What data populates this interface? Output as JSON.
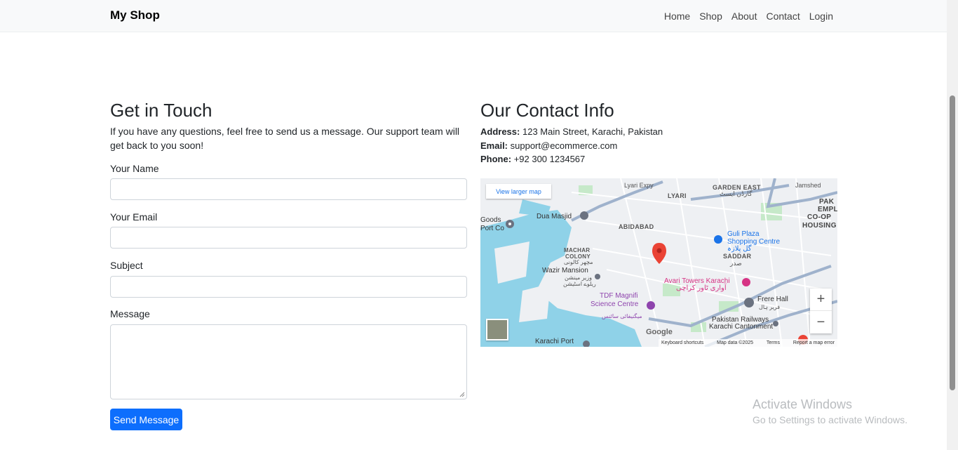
{
  "navbar": {
    "brand": "My Shop",
    "links": [
      "Home",
      "Shop",
      "About",
      "Contact",
      "Login"
    ]
  },
  "contact_form": {
    "title": "Get in Touch",
    "intro": "If you have any questions, feel free to send us a message. Our support team will get back to you soon!",
    "name_label": "Your Name",
    "email_label": "Your Email",
    "subject_label": "Subject",
    "message_label": "Message",
    "submit_label": "Send Message"
  },
  "contact_info": {
    "title": "Our Contact Info",
    "address_label": "Address:",
    "address": "123 Main Street, Karachi, Pakistan",
    "email_label": "Email:",
    "email": "support@ecommerce.com",
    "phone_label": "Phone:",
    "phone": "+92 300 1234567"
  },
  "map": {
    "view_larger": "View larger map",
    "labels": {
      "lyari_expy": "Lyari Expy",
      "lyari": "LYARI",
      "garden_east": "GARDEN EAST",
      "garden_east_ur": "گارڈن ایسٹ",
      "goods": "Goods",
      "port_co": "Port Co",
      "dua_masjid": "Dua Masjid",
      "abidabad": "ABIDABAD",
      "guli_plaza": "Guli Plaza",
      "shopping_centre": "Shopping Centre",
      "guli_plaza_ur": "گل پلازہ",
      "pak": "PAK",
      "empl": "EMPL",
      "co_op": "CO-OP",
      "housing": "HOUSING",
      "machar": "MACHAR",
      "colony": "COLONY",
      "machar_ur": "مچھر کالونی",
      "saddar": "SADDAR",
      "saddar_ur": "صدر",
      "wazir_mansion": "Wazir Mansion",
      "wazir_ur": "وزیر مینشن",
      "wazir_ur2": "ریلوے اسٹیشن",
      "avari": "Avari Towers Karachi",
      "avari_ur": "آواری ٹاور کراچی",
      "tdf_1": "TDF Magnifi",
      "tdf_2": "Science Centre",
      "tdf_ur": "میگنیفائی سائنس",
      "frere_hall": "Frere Hall",
      "frere_ur": "فریر ہال",
      "pak_rail": "Pakistan Railways",
      "karachi_cant": "Karachi Cantonment",
      "karachi_port": "Karachi Port",
      "jamshed": "Jamshed"
    },
    "google": "Google",
    "footer": [
      "Keyboard shortcuts",
      "Map data ©2025",
      "Terms",
      "Report a map error"
    ],
    "zoom_in": "+",
    "zoom_out": "−"
  },
  "watermark": {
    "line1": "Activate Windows",
    "line2": "Go to Settings to activate Windows."
  }
}
